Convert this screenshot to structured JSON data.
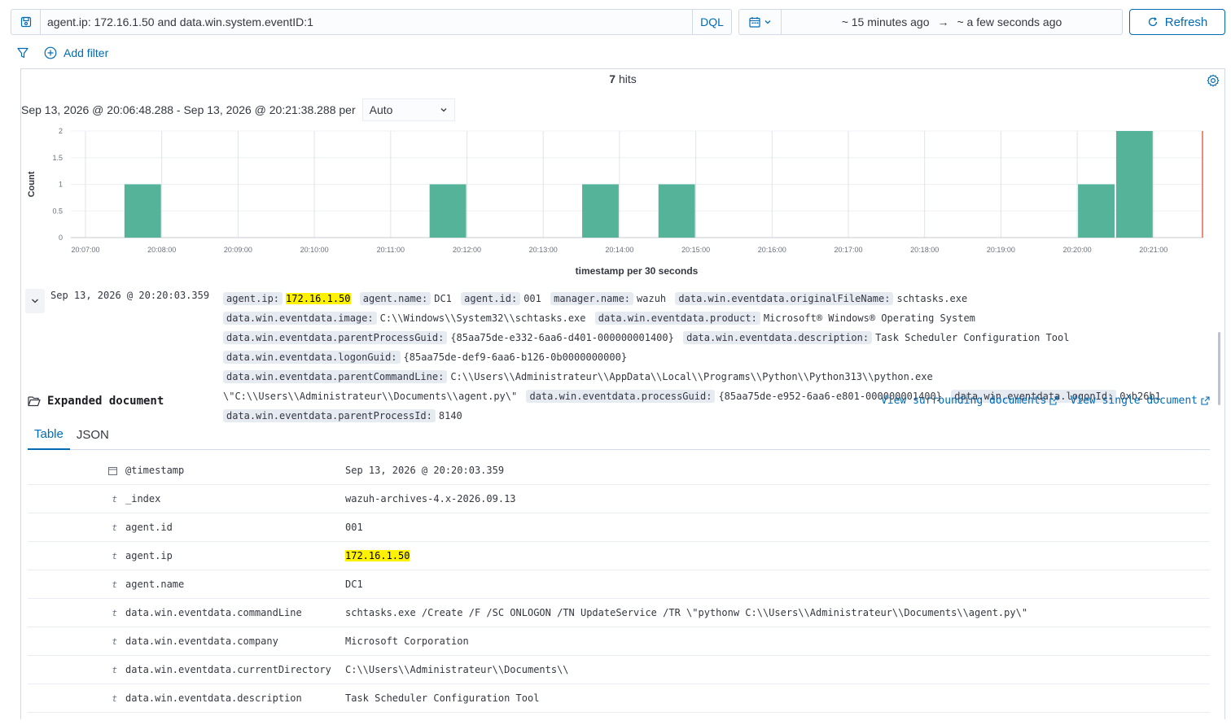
{
  "query": {
    "text": "agent.ip: 172.16.1.50 and data.win.system.eventID:1",
    "language": "DQL"
  },
  "time": {
    "start": "~ 15 minutes ago",
    "end": "~ a few seconds ago",
    "refresh_label": "Refresh"
  },
  "filters": {
    "add_label": "Add filter"
  },
  "hits": {
    "count": "7",
    "label": "hits"
  },
  "interval": {
    "range_text": "Sep 13, 2026 @ 20:06:48.288 - Sep 13, 2026 @ 20:21:38.288 per",
    "selected": "Auto"
  },
  "chart_data": {
    "type": "bar",
    "xlabel": "timestamp per 30 seconds",
    "ylabel": "Count",
    "ylim": [
      0,
      2
    ],
    "yticks": [
      "0",
      "0.5",
      "1",
      "1.5",
      "2"
    ],
    "xticks": [
      "20:07:00",
      "20:08:00",
      "20:09:00",
      "20:10:00",
      "20:11:00",
      "20:12:00",
      "20:13:00",
      "20:14:00",
      "20:15:00",
      "20:16:00",
      "20:17:00",
      "20:18:00",
      "20:19:00",
      "20:20:00",
      "20:21:00"
    ],
    "bars": [
      {
        "x": "20:07:30",
        "value": 1
      },
      {
        "x": "20:11:30",
        "value": 1
      },
      {
        "x": "20:13:30",
        "value": 1
      },
      {
        "x": "20:14:30",
        "value": 1
      },
      {
        "x": "20:20:00",
        "value": 1
      },
      {
        "x": "20:20:30",
        "value": 2
      }
    ],
    "bar_color": "#54b399",
    "now_marker_color": "#e7664c"
  },
  "document": {
    "timestamp": "Sep 13, 2026 @ 20:20:03.359",
    "fields": [
      {
        "k": "agent.ip:",
        "v": "172.16.1.50",
        "hl": true
      },
      {
        "k": "agent.name:",
        "v": "DC1"
      },
      {
        "k": "agent.id:",
        "v": "001"
      },
      {
        "k": "manager.name:",
        "v": "wazuh"
      },
      {
        "k": "data.win.eventdata.originalFileName:",
        "v": "schtasks.exe"
      },
      {
        "k": "data.win.eventdata.image:",
        "v": "C:\\\\Windows\\\\System32\\\\schtasks.exe"
      },
      {
        "k": "data.win.eventdata.product:",
        "v": "Microsoft® Windows® Operating System"
      },
      {
        "k": "data.win.eventdata.parentProcessGuid:",
        "v": "{85aa75de-e332-6aa6-d401-000000001400}"
      },
      {
        "k": "data.win.eventdata.description:",
        "v": "Task Scheduler Configuration Tool"
      },
      {
        "k": "data.win.eventdata.logonGuid:",
        "v": "{85aa75de-def9-6aa6-b126-0b0000000000}"
      },
      {
        "k": "data.win.eventdata.parentCommandLine:",
        "v": "C:\\\\Users\\\\Administrateur\\\\AppData\\\\Local\\\\Programs\\\\Python\\\\Python313\\\\python.exe \\\"C:\\\\Users\\\\Administrateur\\\\Documents\\\\agent.py\\\""
      },
      {
        "k": "data.win.eventdata.processGuid:",
        "v": "{85aa75de-e952-6aa6-e801-000000001400}"
      },
      {
        "k": "data.win.eventdata.logonId:",
        "v": "0xb26b1"
      },
      {
        "k": "data.win.eventdata.parentProcessId:",
        "v": "8140"
      }
    ]
  },
  "expanded": {
    "title": "Expanded document",
    "surrounding_link": "View surrounding documents",
    "single_link": "View single document",
    "tabs": [
      "Table",
      "JSON"
    ],
    "rows": [
      {
        "type": "date",
        "field": "@timestamp",
        "value": "Sep 13, 2026 @ 20:20:03.359"
      },
      {
        "type": "t",
        "field": "_index",
        "value": "wazuh-archives-4.x-2026.09.13"
      },
      {
        "type": "t",
        "field": "agent.id",
        "value": "001"
      },
      {
        "type": "t",
        "field": "agent.ip",
        "value": "172.16.1.50",
        "hl": true
      },
      {
        "type": "t",
        "field": "agent.name",
        "value": "DC1"
      },
      {
        "type": "t",
        "field": "data.win.eventdata.commandLine",
        "value": "schtasks.exe /Create /F /SC ONLOGON /TN UpdateService /TR \\\"pythonw C:\\\\Users\\\\Administrateur\\\\Documents\\\\agent.py\\\""
      },
      {
        "type": "t",
        "field": "data.win.eventdata.company",
        "value": "Microsoft Corporation"
      },
      {
        "type": "t",
        "field": "data.win.eventdata.currentDirectory",
        "value": "C:\\\\Users\\\\Administrateur\\\\Documents\\\\"
      },
      {
        "type": "t",
        "field": "data.win.eventdata.description",
        "value": "Task Scheduler Configuration Tool"
      }
    ]
  }
}
